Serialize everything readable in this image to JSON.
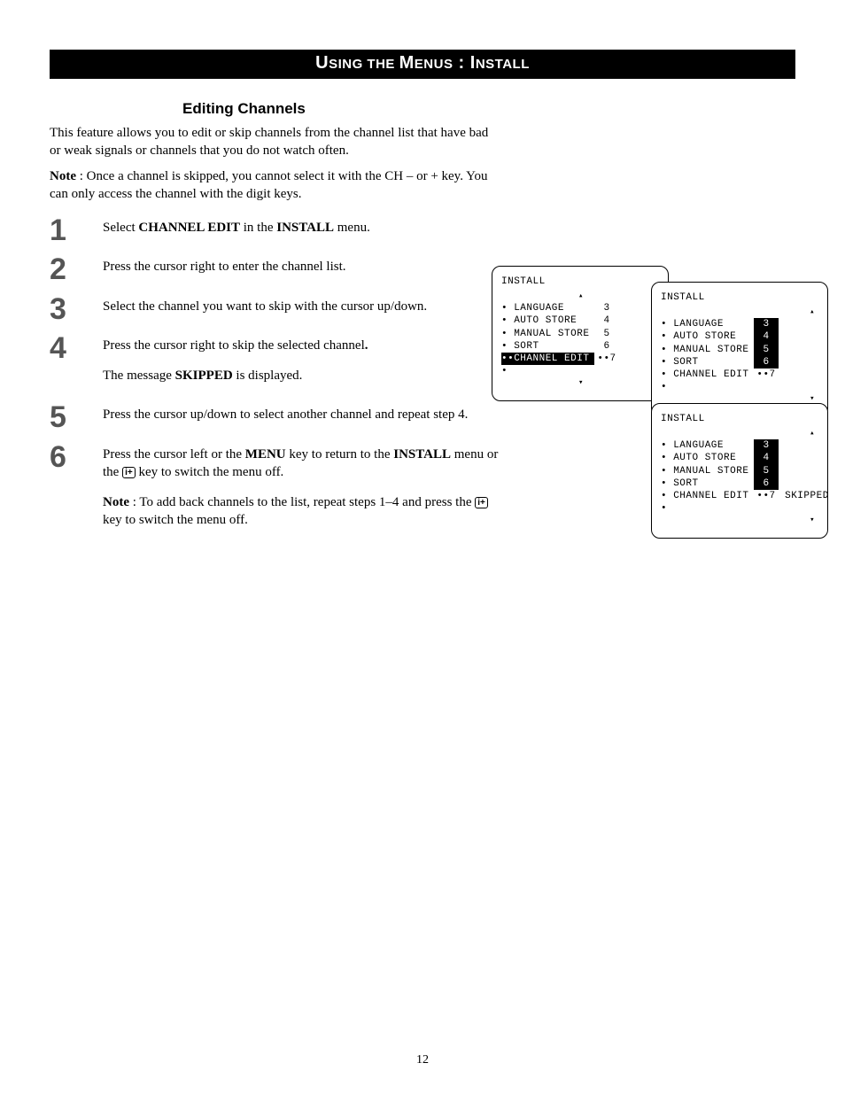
{
  "titlebar": {
    "a": "U",
    "b": "SING",
    "c": " THE ",
    "d": "M",
    "e": "ENUS",
    "f": " : I",
    "g": "NSTALL"
  },
  "section_title": "Editing Channels",
  "intro1": "This feature allows you to edit or skip channels from the channel list that have bad or weak signals or channels that you do not watch often.",
  "intro2a": "Note",
  "intro2b": " : Once a channel is skipped, you cannot select it with the CH – or + key. You can only access the channel with the digit keys.",
  "steps": {
    "n1": "1",
    "n2": "2",
    "n3": "3",
    "n4": "4",
    "n5": "5",
    "n6": "6",
    "s1a": "Select ",
    "s1b": "CHANNEL EDIT",
    "s1c": " in the ",
    "s1d": "INSTALL",
    "s1e": " menu.",
    "s2": "Press the cursor right to enter the channel list.",
    "s3": "Select the channel you want to skip with the cursor up/down.",
    "s4a": "Press the cursor right to skip the selected channel",
    "s4b": ".",
    "s4c_a": "The message ",
    "s4c_b": "SKIPPED",
    "s4c_c": " is displayed.",
    "s5": "Press the cursor up/down to select another channel and repeat step 4.",
    "s6a": "Press the cursor left or the ",
    "s6b": "MENU",
    "s6c": " key to return to the ",
    "s6d": "INSTALL",
    "s6e": " menu or the ",
    "s6f": "i+",
    "s6g": " key to switch the menu off.",
    "s6na": "Note",
    "s6nb": " : To add back channels to the list, repeat steps 1–4 and press the ",
    "s6nc": "i+",
    "s6nd": " key to switch the menu off."
  },
  "osd": {
    "title": "INSTALL",
    "lang": "• LANGUAGE",
    "auto": "• AUTO STORE",
    "man": "• MANUAL STORE",
    "sort": "• SORT",
    "cedit": "• CHANNEL EDIT",
    "ceditsel": "••CHANNEL EDIT",
    "dot": "•",
    "v3": "3",
    "v4": "4",
    "v5": "5",
    "v6": "6",
    "v7a": "••7",
    "skipped": " SKIPPED",
    "up": "▴",
    "down": "▾"
  },
  "pagenum": "12"
}
